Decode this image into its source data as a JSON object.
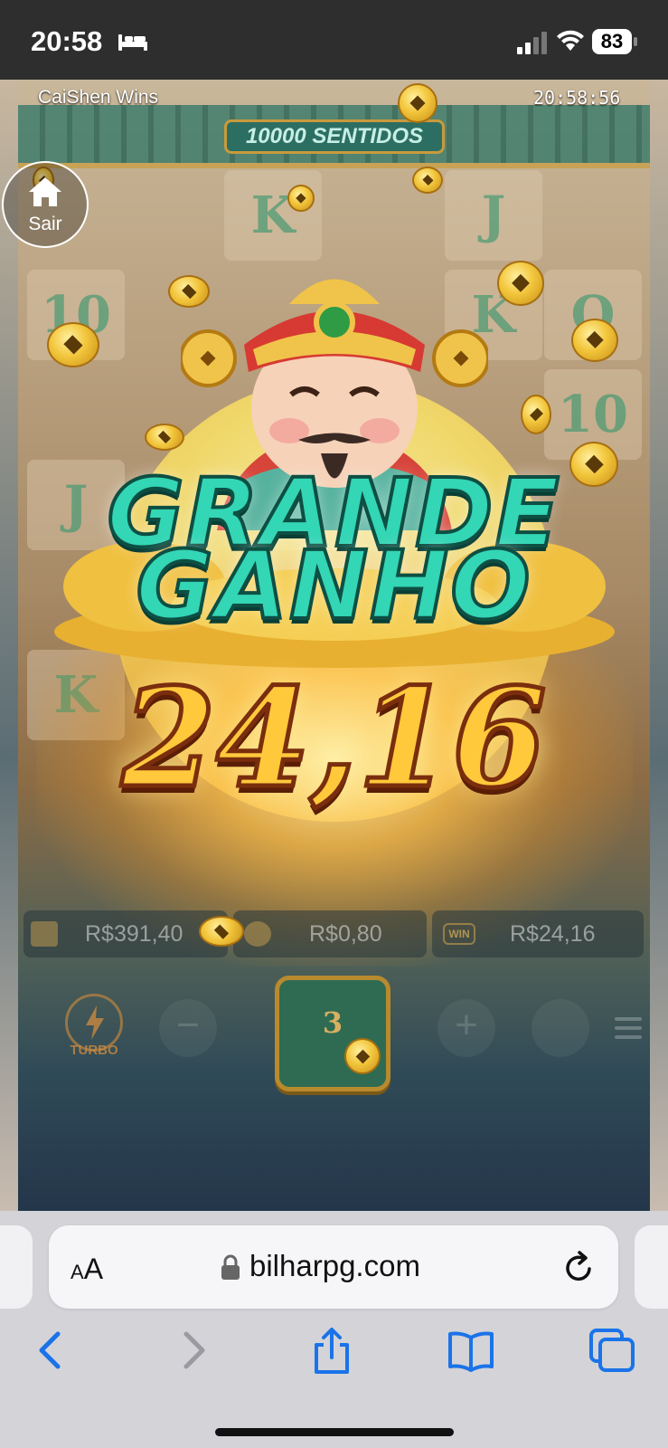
{
  "status_bar": {
    "time": "20:58",
    "battery": "83",
    "icons": [
      "bed-icon",
      "signal-icon",
      "wifi-icon",
      "battery-icon"
    ]
  },
  "game": {
    "title": "CaiShen Wins",
    "clock": "20:58:56",
    "banner": "10000 SENTIDOS",
    "exit_label": "Sair",
    "big_win_line1": "GRANDE",
    "big_win_line2": "GANHO",
    "win_amount": "24,16",
    "balance": "R$391,40",
    "bet": "R$0,80",
    "win": "R$24,16",
    "win_badge": "WIN",
    "turbo_label": "TURBO",
    "spin_count": "3",
    "tiles": [
      "K",
      "J",
      "10",
      "K",
      "Q",
      "10",
      "J",
      "K"
    ],
    "colors": {
      "win_text": "#33d6b5",
      "amount_gold": "#ffc93b",
      "spin_button": "#2e6b52"
    }
  },
  "browser": {
    "text_size_small": "A",
    "text_size_large": "A",
    "url": "bilharpg.com",
    "accent": "#1a73e8",
    "nav_icons": [
      "back-icon",
      "forward-icon",
      "share-icon",
      "bookmarks-icon",
      "tabs-icon"
    ]
  }
}
